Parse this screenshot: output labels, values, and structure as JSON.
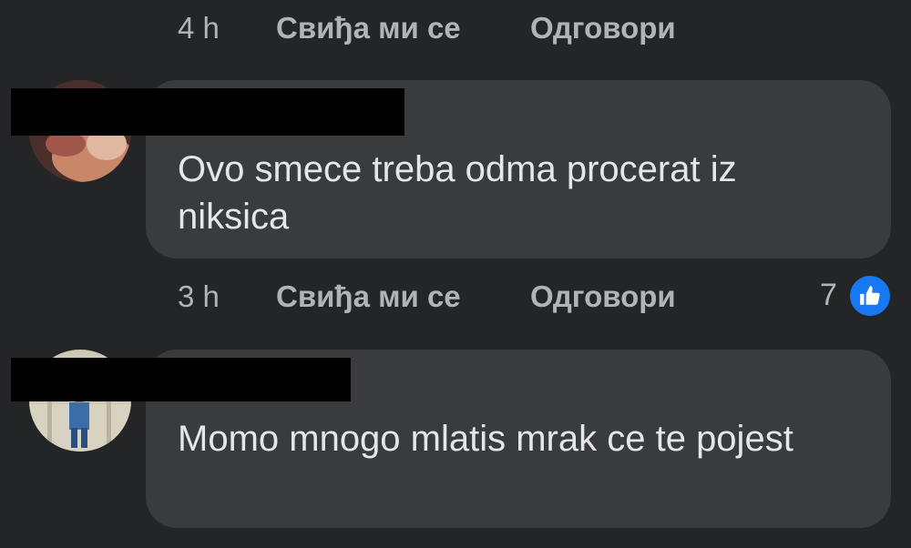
{
  "colors": {
    "background": "#242526",
    "bubble": "#3a3b3c",
    "text": "#e4e6eb",
    "muted": "#b0b3b8",
    "like_blue": "#1877f2"
  },
  "top_actions": {
    "time": "4 h",
    "like_label": "Свиђа ми се",
    "reply_label": "Одговори"
  },
  "comments": [
    {
      "text": "Ovo smece treba odma procerat iz niksica",
      "time": "3 h",
      "like_label": "Свиђа ми се",
      "reply_label": "Одговори",
      "reaction_count": "7",
      "reaction_icon": "thumbs-up-icon"
    },
    {
      "text": "Momo mnogo mlatis mrak ce te pojest"
    }
  ]
}
